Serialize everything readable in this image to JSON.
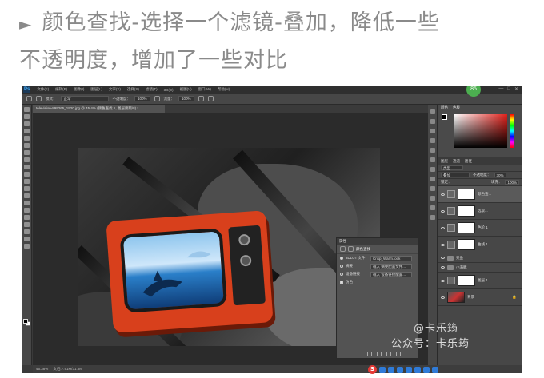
{
  "caption": {
    "bullet": "►",
    "text_line1": "颜色查找-选择一个滤镜-叠加，降低一些",
    "text_line2": "不透明度，增加了一些对比"
  },
  "app": {
    "logo": "Ps",
    "menu": [
      "文件(F)",
      "编辑(E)",
      "图像(I)",
      "图层(L)",
      "文字(Y)",
      "选择(S)",
      "滤镜(T)",
      "3D(D)",
      "视图(V)",
      "窗口(W)",
      "帮助(H)"
    ],
    "window_controls": [
      "—",
      "□",
      "✕"
    ],
    "float_badge": "85"
  },
  "options_bar": {
    "mode_label": "模式：",
    "mode_value": "正常",
    "opacity_label": "不透明度：",
    "opacity_value": "100%",
    "flow_label": "流量：",
    "flow_value": "100%"
  },
  "document": {
    "tab_title": "television-899265_1920.jpg @ 45.4% (颜色查找 1, 图层蒙版/8) *",
    "status_zoom": "45.38%",
    "status_doc": "文档:7.91M/31.8M"
  },
  "color_panel": {
    "tabs": [
      "颜色",
      "色板"
    ]
  },
  "layers_panel": {
    "tabs": [
      "图层",
      "通道",
      "路径"
    ],
    "filter_label": "类型",
    "blend_mode": "叠加",
    "opacity_label": "不透明度：",
    "opacity_value": "30%",
    "lock_label": "锁定：",
    "fill_label": "填充：",
    "fill_value": "100%",
    "layers": [
      {
        "name": "颜色查...",
        "kind": "adjustment",
        "selected": true
      },
      {
        "name": "选取...",
        "kind": "adjustment",
        "selected": false
      },
      {
        "name": "色阶 1",
        "kind": "adjustment",
        "selected": false
      },
      {
        "name": "曲线 1",
        "kind": "adjustment",
        "selected": false
      },
      {
        "name": "天鱼",
        "kind": "group",
        "selected": false
      },
      {
        "name": "小海豚",
        "kind": "group",
        "selected": false
      },
      {
        "name": "图层 1",
        "kind": "mask",
        "selected": false
      },
      {
        "name": "背景",
        "kind": "photo",
        "selected": false
      }
    ]
  },
  "properties_panel": {
    "title": "属性",
    "subtitle": "颜色查找",
    "rows": [
      {
        "label": "3DLUT 文件",
        "value": "Crisp_Warm.look",
        "selected": true
      },
      {
        "label": "摘要",
        "value": "载入 摘要配置文件...",
        "selected": false
      },
      {
        "label": "设备链接",
        "value": "载入 设备链接配置...",
        "selected": false
      }
    ],
    "dither_label": "仿色"
  },
  "watermark": {
    "line1": "@卡乐筠",
    "line2": "公众号：卡乐筠"
  }
}
